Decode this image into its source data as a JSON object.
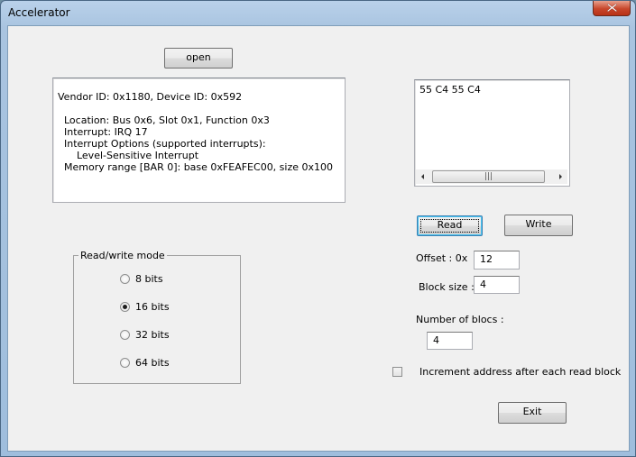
{
  "window": {
    "title": "Accelerator"
  },
  "buttons": {
    "open": "open",
    "read": "Read",
    "write": "Write",
    "exit": "Exit"
  },
  "device_info": {
    "lines": [
      "Vendor ID: 0x1180, Device ID: 0x592",
      "",
      "  Location: Bus 0x6, Slot 0x1, Function 0x3",
      "  Interrupt: IRQ 17",
      "  Interrupt Options (supported interrupts):",
      "      Level-Sensitive Interrupt",
      "  Memory range [BAR 0]: base 0xFEAFEC00, size 0x100"
    ]
  },
  "output": {
    "text": "55 C4 55 C4"
  },
  "mode": {
    "legend": "Read/write mode",
    "options": [
      "8 bits",
      "16 bits",
      "32 bits",
      "64 bits"
    ],
    "selected": "16 bits"
  },
  "offset": {
    "label": "Offset :  0x",
    "value": "12"
  },
  "block_size": {
    "label": "Block size :",
    "value": "4"
  },
  "num_blocs": {
    "label": "Number of blocs :",
    "value": "4"
  },
  "increment": {
    "label": "Increment address after each read block",
    "checked": false
  }
}
